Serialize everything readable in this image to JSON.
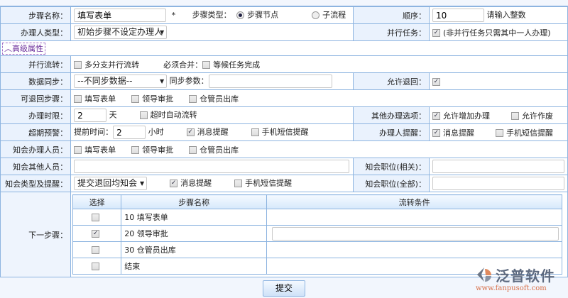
{
  "row1": {
    "name_label": "步骤名称：",
    "name_value": "填写表单",
    "required": "*",
    "type_label": "步骤类型：",
    "type_options": [
      "步骤节点",
      "子流程"
    ],
    "type_selected": "步骤节点",
    "order_label": "顺序：",
    "order_value": "10",
    "order_hint": "请输入整数"
  },
  "row2": {
    "handler_label": "办理人类型：",
    "handler_value": "初始步骤不设定办理人",
    "parallel_label": "并行任务：",
    "parallel_checked": true,
    "parallel_hint": "(非并行任务只需其中一人办理)"
  },
  "advanced": "高级属性",
  "row3": {
    "label": "并行流转：",
    "option": "多分支并行流转",
    "merge_label": "必须合并：",
    "merge_option": "等候任务完成"
  },
  "row4": {
    "label": "数据同步：",
    "select_value": "--不同步数据--",
    "param_label": "同步参数：",
    "param_value": "",
    "return_label": "允许退回：",
    "return_checked": true
  },
  "row5": {
    "label": "可退回步骤：",
    "options": [
      {
        "label": "填写表单",
        "checked": false
      },
      {
        "label": "领导审批",
        "checked": false
      },
      {
        "label": "仓管员出库",
        "checked": false
      }
    ]
  },
  "row6": {
    "label": "办理时限：",
    "value": "2",
    "unit": "天",
    "auto": "超时自动流转",
    "other_label": "其他办理选项：",
    "other_options": [
      {
        "label": "允许增加办理",
        "checked": true
      },
      {
        "label": "允许作废",
        "checked": false
      }
    ]
  },
  "row7": {
    "label": "超期预警：",
    "advance_label": "提前时间：",
    "advance_value": "2",
    "unit": "小时",
    "options": [
      {
        "label": "消息提醒",
        "checked": true
      },
      {
        "label": "手机短信提醒",
        "checked": false
      }
    ],
    "remind_label": "办理人提醒：",
    "remind_options": [
      {
        "label": "消息提醒",
        "checked": true
      },
      {
        "label": "手机短信提醒",
        "checked": false
      }
    ]
  },
  "row8": {
    "label": "知会办理人员：",
    "options": [
      {
        "label": "填写表单",
        "checked": false
      },
      {
        "label": "领导审批",
        "checked": false
      },
      {
        "label": "仓管员出库",
        "checked": false
      }
    ]
  },
  "row9": {
    "label": "知会其他人员：",
    "value": "",
    "pos_label": "知会职位(相关)：",
    "pos_value": ""
  },
  "row10": {
    "label": "知会类型及提醒：",
    "select_value": "提交退回均知会",
    "options": [
      {
        "label": "消息提醒",
        "checked": true
      },
      {
        "label": "手机短信提醒",
        "checked": false
      }
    ],
    "pos_label": "知会职位(全部)：",
    "pos_value": ""
  },
  "next": {
    "label": "下一步骤：",
    "headers": [
      "选择",
      "步骤名称",
      "流转条件"
    ],
    "rows": [
      {
        "name": "10 填写表单",
        "checked": false
      },
      {
        "name": "20 领导审批",
        "checked": true
      },
      {
        "name": "30 仓管员出库",
        "checked": false
      },
      {
        "name": "结束",
        "checked": false
      }
    ]
  },
  "submit": "提交",
  "logo": {
    "text": "泛普软件",
    "url": "www.fanpusoft.com"
  }
}
